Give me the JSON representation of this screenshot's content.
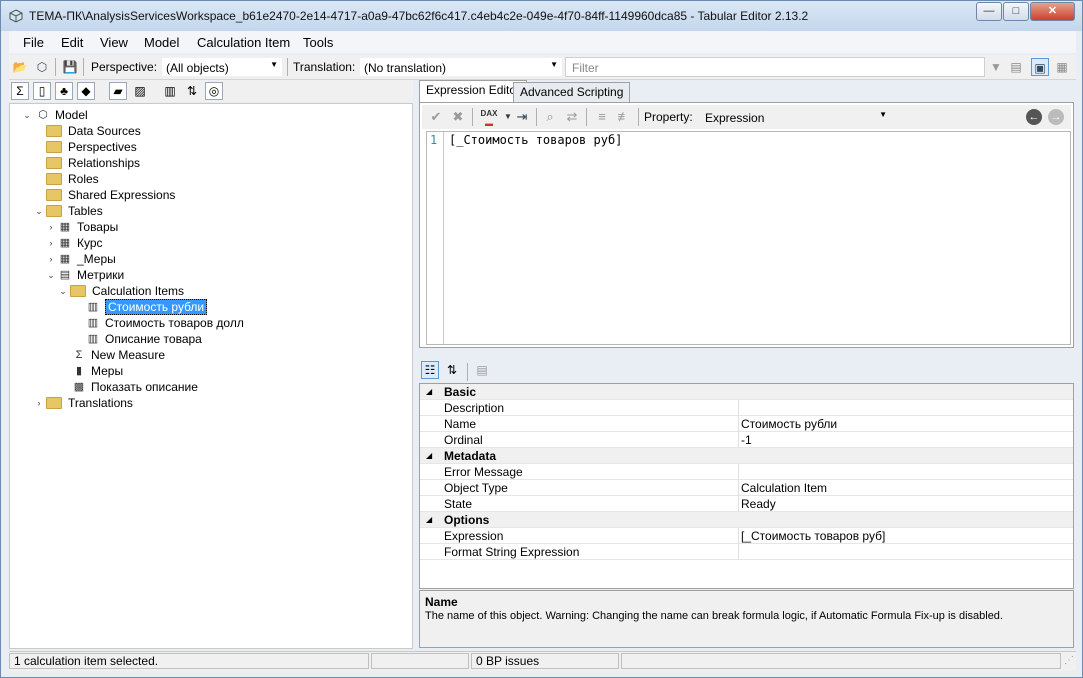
{
  "window": {
    "title": "TEMA-ПК\\AnalysisServicesWorkspace_b61e2470-2e14-4717-a0a9-47bc62f6c417.c4eb4c2e-049e-4f70-84ff-1149960dca85 - Tabular Editor 2.13.2"
  },
  "window_controls": {
    "minimize": "—",
    "maximize": "□",
    "close": "✕"
  },
  "menu": {
    "file": "File",
    "edit": "Edit",
    "view": "View",
    "model": "Model",
    "calc": "Calculation Item",
    "tools": "Tools"
  },
  "toolbar": {
    "perspective_label": "Perspective:",
    "perspective_value": "(All objects)",
    "translation_label": "Translation:",
    "translation_value": "(No translation)",
    "filter_placeholder": "Filter"
  },
  "tree": {
    "model": "Model",
    "data_sources": "Data Sources",
    "perspectives": "Perspectives",
    "relationships": "Relationships",
    "roles": "Roles",
    "shared_expressions": "Shared Expressions",
    "tables": "Tables",
    "t1": "Товары",
    "t2": "Курс",
    "t3": "_Меры",
    "t4": "Метрики",
    "calc_items": "Calculation Items",
    "ci1": "Стоимость рубли",
    "ci2": "Стоимость товаров долл",
    "ci3": "Описание товара",
    "new_measure": "New Measure",
    "measures": "Меры",
    "show_desc": "Показать описание",
    "translations": "Translations"
  },
  "tabs": {
    "expression_editor": "Expression Editor",
    "advanced_scripting": "Advanced Scripting"
  },
  "editor": {
    "property_label": "Property:",
    "property_value": "Expression",
    "dax_label": "DAX",
    "line_number": "1",
    "code": "[_Стоимость товаров руб]"
  },
  "properties": {
    "basic": "Basic",
    "description": "Description",
    "name": "Name",
    "name_value": "Стоимость рубли",
    "ordinal": "Ordinal",
    "ordinal_value": "-1",
    "metadata": "Metadata",
    "error_message": "Error Message",
    "object_type": "Object Type",
    "object_type_value": "Calculation Item",
    "state": "State",
    "state_value": "Ready",
    "options": "Options",
    "expression": "Expression",
    "expression_value": "[_Стоимость товаров руб]",
    "format_string": "Format String Expression"
  },
  "description_panel": {
    "title": "Name",
    "text": "The name of this object. Warning: Changing the name can break formula logic, if Automatic Formula Fix-up is disabled."
  },
  "status": {
    "left": "1 calculation item selected.",
    "bp": "0 BP issues"
  }
}
